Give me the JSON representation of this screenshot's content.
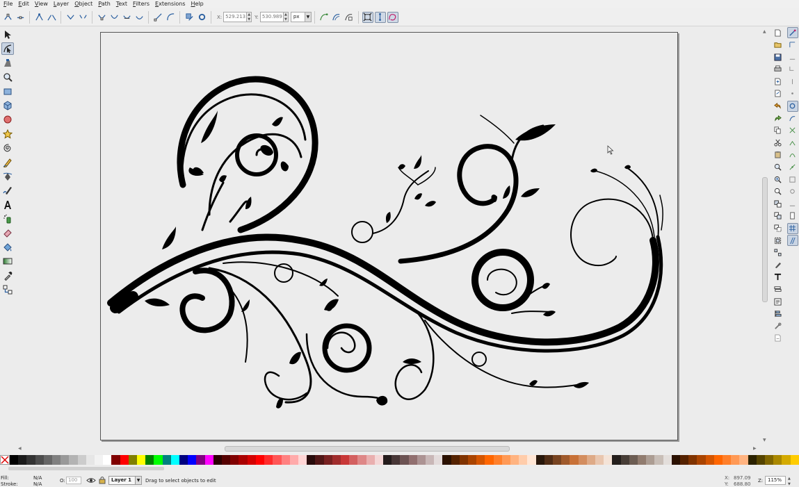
{
  "menu": [
    "File",
    "Edit",
    "View",
    "Layer",
    "Object",
    "Path",
    "Text",
    "Filters",
    "Extensions",
    "Help"
  ],
  "controls": {
    "x_label": "X:",
    "x_value": "529.213",
    "y_label": "Y:",
    "y_value": "530.989",
    "unit": "px"
  },
  "toolbox": [
    "selector-tool",
    "node-tool",
    "tweak-tool",
    "zoom-tool",
    "rectangle-tool",
    "3d-box-tool",
    "ellipse-tool",
    "star-tool",
    "spiral-tool",
    "pencil-tool",
    "pen-tool",
    "calligraphy-tool",
    "text-tool",
    "spray-tool",
    "eraser-tool",
    "paint-bucket-tool",
    "gradient-tool",
    "dropper-tool",
    "connector-tool"
  ],
  "palette": [
    "#000000",
    "#1a1a1a",
    "#333333",
    "#4d4d4d",
    "#666666",
    "#808080",
    "#999999",
    "#b3b3b3",
    "#cccccc",
    "#e6e6e6",
    "#f2f2f2",
    "#ffffff",
    "#800000",
    "#ff0000",
    "#808000",
    "#ffff00",
    "#008000",
    "#00ff00",
    "#008080",
    "#00ffff",
    "#000080",
    "#0000ff",
    "#800080",
    "#ff00ff",
    "#2b0000",
    "#550000",
    "#800000",
    "#aa0000",
    "#d40000",
    "#ff0000",
    "#ff2a2a",
    "#ff5555",
    "#ff8080",
    "#ffaaaa",
    "#ffd5d5",
    "#280b0b",
    "#501616",
    "#782121",
    "#a02c2c",
    "#c83737",
    "#d35f5f",
    "#de8787",
    "#e9afaf",
    "#f4d7d7",
    "#241c1c",
    "#483737",
    "#6c5353",
    "#916f6f",
    "#ac9393",
    "#c8b7b7",
    "#e3dbdb",
    "#2b1100",
    "#552200",
    "#803300",
    "#aa4400",
    "#d45500",
    "#ff6600",
    "#ff7f2a",
    "#ff9955",
    "#ffb380",
    "#ffccaa",
    "#ffe6d5",
    "#28170b",
    "#502d16",
    "#784421",
    "#a05a2c",
    "#c87137",
    "#d38d5f",
    "#deaa87",
    "#e9c6af",
    "#f4e3d7",
    "#241f1c",
    "#483e37",
    "#6c5d53",
    "#917c6f",
    "#ac9d93",
    "#c8beb7",
    "#e3dedb",
    "#2b1100",
    "#552200",
    "#803300",
    "#aa4400",
    "#d45500",
    "#ff6600",
    "#ff7f2a",
    "#ff9955",
    "#ffb380",
    "#2b2200",
    "#554400",
    "#806600",
    "#aa8800",
    "#d4aa00",
    "#ffcc00"
  ],
  "status": {
    "fill_label": "Fill:",
    "fill_value": "N/A",
    "stroke_label": "Stroke:",
    "stroke_value": "N/A",
    "opacity_label": "O:",
    "opacity_value": "100",
    "layer": "Layer 1",
    "message": "Drag to select objects to edit",
    "x_label": "X:",
    "x_coord": "897.09",
    "y_label": "Y:",
    "y_coord": "688.80",
    "zoom_label": "Z:",
    "zoom": "115%"
  }
}
